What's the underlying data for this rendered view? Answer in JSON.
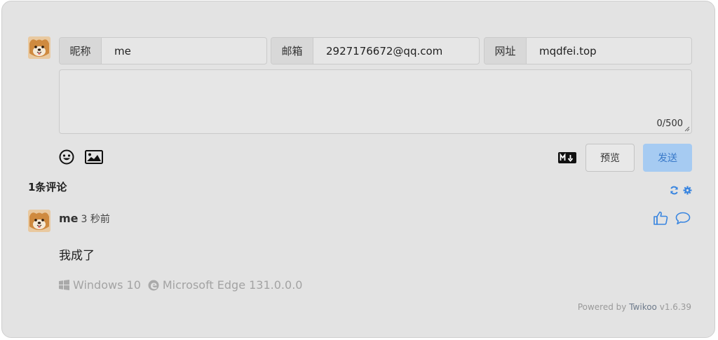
{
  "form": {
    "nick_label": "昵称",
    "nick_value": "me",
    "mail_label": "邮箱",
    "mail_value": "2927176672@qq.com",
    "link_label": "网址",
    "link_value": "mqdfei.top",
    "textarea_counter": "0/500",
    "preview_label": "预览",
    "send_label": "发送",
    "icons": [
      "emoji-icon",
      "image-upload-icon",
      "markdown-icon"
    ]
  },
  "comments_header": {
    "count_label": "1条评论",
    "icons": [
      "refresh-icon",
      "settings-icon"
    ]
  },
  "comment": {
    "nick": "me",
    "time": "3 秒前",
    "content": "我成了",
    "os": "Windows 10",
    "browser": "Microsoft Edge 131.0.0.0",
    "icons": [
      "like-icon",
      "reply-icon",
      "windows-icon",
      "edge-icon"
    ]
  },
  "footer": {
    "powered_prefix": "Powered by ",
    "brand": "Twikoo",
    "version": " v1.6.39"
  },
  "colors": {
    "card_bg": "#e3e3e3",
    "accent": "#3a86e0",
    "send_bg": "#a6cbf2",
    "meta_text": "#a3a3a3"
  }
}
